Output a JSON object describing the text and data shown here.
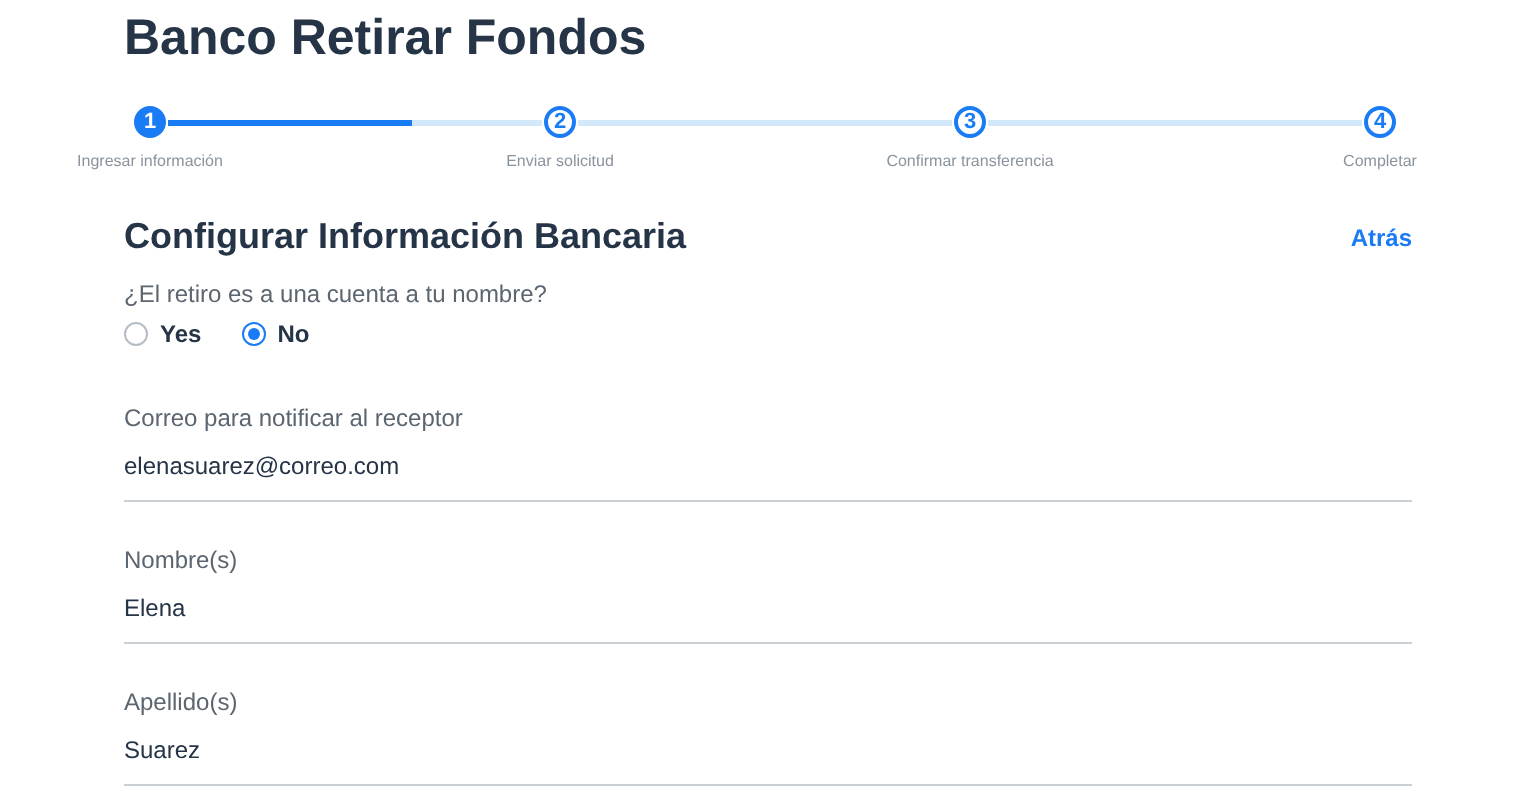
{
  "title": "Banco Retirar Fondos",
  "steps": [
    {
      "number": "1",
      "label": "Ingresar información",
      "active": true,
      "level": 0.65
    },
    {
      "number": "2",
      "label": "Enviar solicitud",
      "active": false,
      "level": 0
    },
    {
      "number": "3",
      "label": "Confirmar transferencia",
      "active": false,
      "level": 0
    },
    {
      "number": "4",
      "label": "Completar",
      "active": false
    }
  ],
  "section": {
    "heading": "Configurar Información Bancaria",
    "back_link": "Atrás"
  },
  "question": {
    "label": "¿El retiro es a una cuenta a tu nombre?",
    "options": [
      {
        "label": "Yes",
        "selected": false
      },
      {
        "label": "No",
        "selected": true
      }
    ]
  },
  "fields": [
    {
      "label": "Correo para notificar al receptor",
      "value": "elenasuarez@correo.com"
    },
    {
      "label": "Nombre(s)",
      "value": "Elena"
    },
    {
      "label": "Apellido(s)",
      "value": "Suarez"
    }
  ]
}
